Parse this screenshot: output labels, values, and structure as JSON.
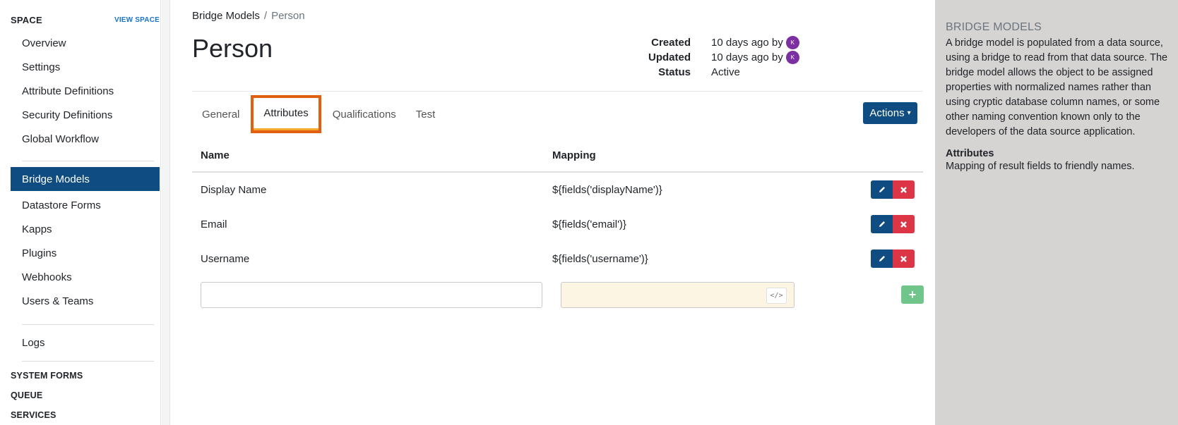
{
  "sidebar": {
    "title": "SPACE",
    "view_link": "VIEW SPACE",
    "items": [
      {
        "label": "Overview"
      },
      {
        "label": "Settings"
      },
      {
        "label": "Attribute Definitions"
      },
      {
        "label": "Security Definitions"
      },
      {
        "label": "Global Workflow"
      },
      {
        "label": "Bridge Models"
      },
      {
        "label": "Datastore Forms"
      },
      {
        "label": "Kapps"
      },
      {
        "label": "Plugins"
      },
      {
        "label": "Webhooks"
      },
      {
        "label": "Users & Teams"
      },
      {
        "label": "Logs"
      }
    ],
    "sections": [
      "SYSTEM FORMS",
      "QUEUE",
      "SERVICES"
    ]
  },
  "breadcrumb": {
    "parent": "Bridge Models",
    "separator": "/",
    "current": "Person"
  },
  "page": {
    "title": "Person"
  },
  "meta": {
    "created_label": "Created",
    "created_value": "10 days ago by",
    "updated_label": "Updated",
    "updated_value": "10 days ago by",
    "status_label": "Status",
    "status_value": "Active",
    "avatar_initial": "K"
  },
  "tabs": [
    {
      "label": "General"
    },
    {
      "label": "Attributes",
      "active": true
    },
    {
      "label": "Qualifications"
    },
    {
      "label": "Test"
    }
  ],
  "actions_button": "Actions",
  "table": {
    "headers": {
      "name": "Name",
      "mapping": "Mapping"
    },
    "rows": [
      {
        "name": "Display Name",
        "mapping": "${fields('displayName')}"
      },
      {
        "name": "Email",
        "mapping": "${fields('email')}"
      },
      {
        "name": "Username",
        "mapping": "${fields('username')}"
      }
    ],
    "new_row": {
      "name_value": "",
      "mapping_value": "",
      "code_icon": "</>"
    }
  },
  "aside": {
    "title": "BRIDGE MODELS",
    "description": "A bridge model is populated from a data source, using a bridge to read from that data source. The bridge model allows the object to be assigned properties with normalized names rather than using cryptic database column names, or some other naming convention known only to the developers of the data source application.",
    "sub_title": "Attributes",
    "sub_text": "Mapping of result fields to friendly names."
  },
  "colors": {
    "primary": "#0f4c81",
    "danger": "#dc3545",
    "success": "#6fc58a",
    "highlight": "#e06010",
    "tab_underline": "#f7a92d"
  }
}
